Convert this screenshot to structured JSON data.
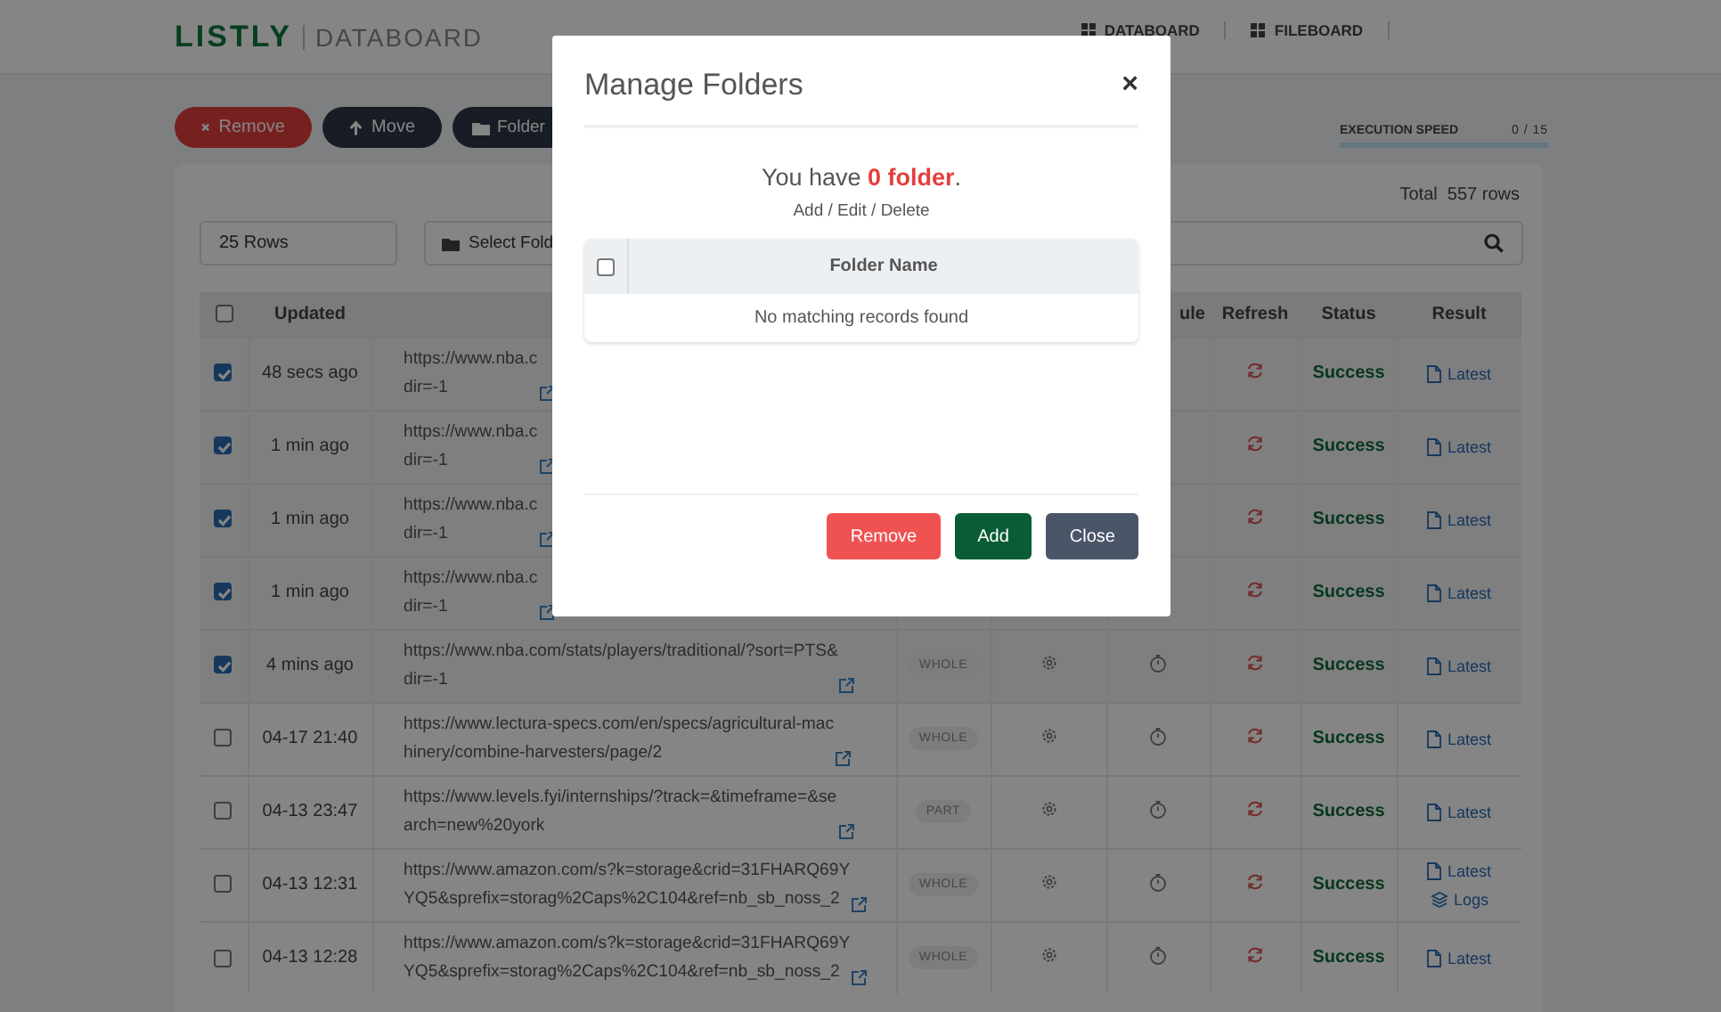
{
  "header": {
    "logo": "LISTLY",
    "section": "DATABOARD",
    "nav": [
      {
        "label": "DATABOARD"
      },
      {
        "label": "FILEBOARD"
      }
    ]
  },
  "toolbar": {
    "buttons": [
      {
        "kind": "remove",
        "label": "Remove"
      },
      {
        "kind": "move",
        "label": "Move"
      },
      {
        "kind": "folder",
        "label": "Folder"
      }
    ],
    "execution_speed": {
      "label": "EXECUTION SPEED",
      "reading": "0 / 15",
      "level": 0
    }
  },
  "total": "Total  557 rows",
  "filters": {
    "rows_select": "25 Rows",
    "folder_select": "Select Fold"
  },
  "table": {
    "header_checked": false,
    "columns": [
      "Updated",
      "ule",
      "Refresh",
      "Status",
      "Result"
    ],
    "rows": [
      {
        "checked": true,
        "updated": "48 secs ago",
        "url": [
          "https://www.nba.c",
          "dir=-1"
        ],
        "status": "Success",
        "results": [
          {
            "kind": "latest",
            "label": "Latest"
          }
        ]
      },
      {
        "checked": true,
        "updated": "1 min ago",
        "url": [
          "https://www.nba.c",
          "dir=-1"
        ],
        "status": "Success",
        "results": [
          {
            "kind": "latest",
            "label": "Latest"
          }
        ]
      },
      {
        "checked": true,
        "updated": "1 min ago",
        "url": [
          "https://www.nba.c",
          "dir=-1"
        ],
        "status": "Success",
        "results": [
          {
            "kind": "latest",
            "label": "Latest"
          }
        ]
      },
      {
        "checked": true,
        "updated": "1 min ago",
        "url": [
          "https://www.nba.c",
          "dir=-1"
        ],
        "status": "Success",
        "results": [
          {
            "kind": "latest",
            "label": "Latest"
          }
        ]
      },
      {
        "checked": true,
        "updated": "4 mins ago",
        "url": [
          "https://www.nba.com/stats/players/traditional/?sort=PTS&",
          "dir=-1"
        ],
        "mode": "WHOLE",
        "status": "Success",
        "results": [
          {
            "kind": "latest",
            "label": "Latest"
          }
        ]
      },
      {
        "checked": false,
        "updated": "04-17 21:40",
        "url": [
          "https://www.lectura-specs.com/en/specs/agricultural-mac",
          "hinery/combine-harvesters/page/2"
        ],
        "mode": "WHOLE",
        "status": "Success",
        "results": [
          {
            "kind": "latest",
            "label": "Latest"
          }
        ]
      },
      {
        "checked": false,
        "updated": "04-13 23:47",
        "url": [
          "https://www.levels.fyi/internships/?track=&timeframe=&se",
          "arch=new%20york"
        ],
        "mode": "PART",
        "status": "Success",
        "results": [
          {
            "kind": "latest",
            "label": "Latest"
          }
        ]
      },
      {
        "checked": false,
        "updated": "04-13 12:31",
        "url": [
          "https://www.amazon.com/s?k=storage&crid=31FHARQ69Y",
          "YQ5&sprefix=storag%2Caps%2C104&ref=nb_sb_noss_2"
        ],
        "mode": "WHOLE",
        "status": "Success",
        "results": [
          {
            "kind": "latest",
            "label": "Latest"
          },
          {
            "kind": "logs",
            "label": "Logs"
          }
        ]
      },
      {
        "checked": false,
        "updated": "04-13 12:28",
        "url": [
          "https://www.amazon.com/s?k=storage&crid=31FHARQ69Y",
          "YQ5&sprefix=storag%2Caps%2C104&ref=nb_sb_noss_2"
        ],
        "mode": "WHOLE",
        "status": "Success",
        "results": [
          {
            "kind": "latest",
            "label": "Latest"
          }
        ]
      }
    ]
  },
  "modal": {
    "title": "Manage Folders",
    "close": "×",
    "summary": "You have **0 folder**.",
    "subtitle": "Add / Edit / Delete",
    "table": {
      "header_checked": false,
      "columns": [
        "Folder Name"
      ],
      "empty_message": "No matching records found"
    },
    "buttons": [
      {
        "kind": "remove",
        "label": "Remove"
      },
      {
        "kind": "add",
        "label": "Add"
      },
      {
        "kind": "close",
        "label": "Close"
      }
    ]
  }
}
